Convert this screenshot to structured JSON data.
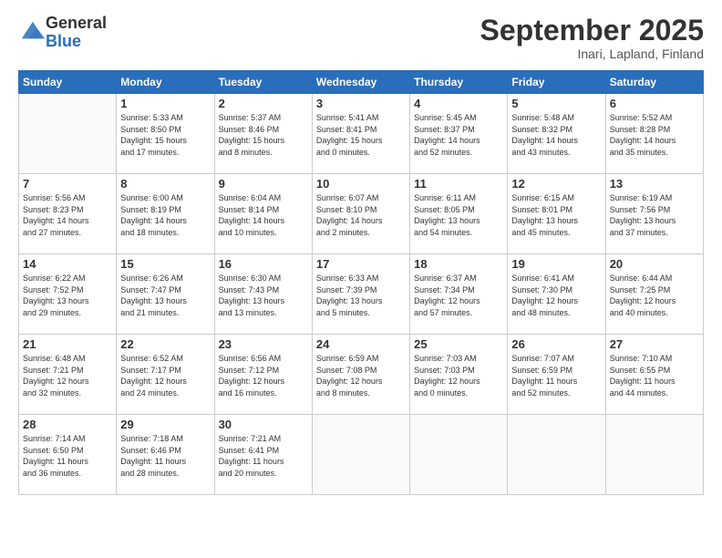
{
  "header": {
    "logo_general": "General",
    "logo_blue": "Blue",
    "month_title": "September 2025",
    "subtitle": "Inari, Lapland, Finland"
  },
  "days_of_week": [
    "Sunday",
    "Monday",
    "Tuesday",
    "Wednesday",
    "Thursday",
    "Friday",
    "Saturday"
  ],
  "weeks": [
    [
      {
        "day": "",
        "info": ""
      },
      {
        "day": "1",
        "info": "Sunrise: 5:33 AM\nSunset: 8:50 PM\nDaylight: 15 hours\nand 17 minutes."
      },
      {
        "day": "2",
        "info": "Sunrise: 5:37 AM\nSunset: 8:46 PM\nDaylight: 15 hours\nand 8 minutes."
      },
      {
        "day": "3",
        "info": "Sunrise: 5:41 AM\nSunset: 8:41 PM\nDaylight: 15 hours\nand 0 minutes."
      },
      {
        "day": "4",
        "info": "Sunrise: 5:45 AM\nSunset: 8:37 PM\nDaylight: 14 hours\nand 52 minutes."
      },
      {
        "day": "5",
        "info": "Sunrise: 5:48 AM\nSunset: 8:32 PM\nDaylight: 14 hours\nand 43 minutes."
      },
      {
        "day": "6",
        "info": "Sunrise: 5:52 AM\nSunset: 8:28 PM\nDaylight: 14 hours\nand 35 minutes."
      }
    ],
    [
      {
        "day": "7",
        "info": "Sunrise: 5:56 AM\nSunset: 8:23 PM\nDaylight: 14 hours\nand 27 minutes."
      },
      {
        "day": "8",
        "info": "Sunrise: 6:00 AM\nSunset: 8:19 PM\nDaylight: 14 hours\nand 18 minutes."
      },
      {
        "day": "9",
        "info": "Sunrise: 6:04 AM\nSunset: 8:14 PM\nDaylight: 14 hours\nand 10 minutes."
      },
      {
        "day": "10",
        "info": "Sunrise: 6:07 AM\nSunset: 8:10 PM\nDaylight: 14 hours\nand 2 minutes."
      },
      {
        "day": "11",
        "info": "Sunrise: 6:11 AM\nSunset: 8:05 PM\nDaylight: 13 hours\nand 54 minutes."
      },
      {
        "day": "12",
        "info": "Sunrise: 6:15 AM\nSunset: 8:01 PM\nDaylight: 13 hours\nand 45 minutes."
      },
      {
        "day": "13",
        "info": "Sunrise: 6:19 AM\nSunset: 7:56 PM\nDaylight: 13 hours\nand 37 minutes."
      }
    ],
    [
      {
        "day": "14",
        "info": "Sunrise: 6:22 AM\nSunset: 7:52 PM\nDaylight: 13 hours\nand 29 minutes."
      },
      {
        "day": "15",
        "info": "Sunrise: 6:26 AM\nSunset: 7:47 PM\nDaylight: 13 hours\nand 21 minutes."
      },
      {
        "day": "16",
        "info": "Sunrise: 6:30 AM\nSunset: 7:43 PM\nDaylight: 13 hours\nand 13 minutes."
      },
      {
        "day": "17",
        "info": "Sunrise: 6:33 AM\nSunset: 7:39 PM\nDaylight: 13 hours\nand 5 minutes."
      },
      {
        "day": "18",
        "info": "Sunrise: 6:37 AM\nSunset: 7:34 PM\nDaylight: 12 hours\nand 57 minutes."
      },
      {
        "day": "19",
        "info": "Sunrise: 6:41 AM\nSunset: 7:30 PM\nDaylight: 12 hours\nand 48 minutes."
      },
      {
        "day": "20",
        "info": "Sunrise: 6:44 AM\nSunset: 7:25 PM\nDaylight: 12 hours\nand 40 minutes."
      }
    ],
    [
      {
        "day": "21",
        "info": "Sunrise: 6:48 AM\nSunset: 7:21 PM\nDaylight: 12 hours\nand 32 minutes."
      },
      {
        "day": "22",
        "info": "Sunrise: 6:52 AM\nSunset: 7:17 PM\nDaylight: 12 hours\nand 24 minutes."
      },
      {
        "day": "23",
        "info": "Sunrise: 6:56 AM\nSunset: 7:12 PM\nDaylight: 12 hours\nand 16 minutes."
      },
      {
        "day": "24",
        "info": "Sunrise: 6:59 AM\nSunset: 7:08 PM\nDaylight: 12 hours\nand 8 minutes."
      },
      {
        "day": "25",
        "info": "Sunrise: 7:03 AM\nSunset: 7:03 PM\nDaylight: 12 hours\nand 0 minutes."
      },
      {
        "day": "26",
        "info": "Sunrise: 7:07 AM\nSunset: 6:59 PM\nDaylight: 11 hours\nand 52 minutes."
      },
      {
        "day": "27",
        "info": "Sunrise: 7:10 AM\nSunset: 6:55 PM\nDaylight: 11 hours\nand 44 minutes."
      }
    ],
    [
      {
        "day": "28",
        "info": "Sunrise: 7:14 AM\nSunset: 6:50 PM\nDaylight: 11 hours\nand 36 minutes."
      },
      {
        "day": "29",
        "info": "Sunrise: 7:18 AM\nSunset: 6:46 PM\nDaylight: 11 hours\nand 28 minutes."
      },
      {
        "day": "30",
        "info": "Sunrise: 7:21 AM\nSunset: 6:41 PM\nDaylight: 11 hours\nand 20 minutes."
      },
      {
        "day": "",
        "info": ""
      },
      {
        "day": "",
        "info": ""
      },
      {
        "day": "",
        "info": ""
      },
      {
        "day": "",
        "info": ""
      }
    ]
  ]
}
